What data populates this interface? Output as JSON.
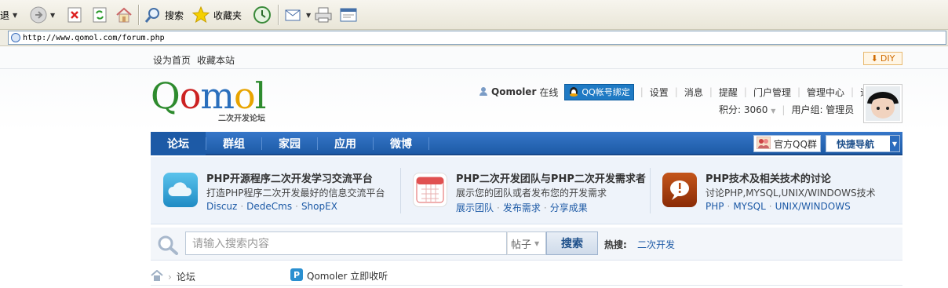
{
  "browser": {
    "toolbar": {
      "back_label": "退",
      "search_label": "搜索",
      "favorites_label": "收藏夹"
    },
    "address": "http://www.qomol.com/forum.php"
  },
  "topbar": {
    "set_home": "设为首页",
    "bookmark": "收藏本站",
    "diy": "DIY"
  },
  "logo": {
    "text": "Qomol",
    "subtitle": "二次开发论坛",
    "letter_colors": [
      "#2e8b2e",
      "#cc2222",
      "#2a6fbd",
      "#e8a400",
      "#2e8b2e"
    ]
  },
  "user": {
    "name": "Qomoler",
    "status": "在线",
    "qq_bind": "QQ帐号绑定",
    "links": [
      "设置",
      "消息",
      "提醒",
      "门户管理",
      "管理中心",
      "退出"
    ],
    "points_label": "积分: 3060",
    "group_label": "用户组: 管理员"
  },
  "nav": {
    "items": [
      "论坛",
      "群组",
      "家园",
      "应用",
      "微博"
    ],
    "active_index": 0,
    "qq_group": "官方QQ群",
    "quick_nav": "快捷导航"
  },
  "intro": [
    {
      "title": "PHP开源程序二次开发学习交流平台",
      "desc": "打造PHP程序二次开发最好的信息交流平台",
      "links": [
        "Discuz",
        "DedeCms",
        "ShopEX"
      ],
      "icon": "cloud-icon",
      "color": "#2a9bd0"
    },
    {
      "title": "PHP二次开发团队与PHP二次开发需求者",
      "desc": "展示您的团队或者发布您的开发需求",
      "links": [
        "展示团队",
        "发布需求",
        "分享成果"
      ],
      "icon": "calendar-icon",
      "color": "#d84a4a"
    },
    {
      "title": "PHP技术及相关技术的讨论",
      "desc": "讨论PHP,MYSQL,UNIX/WINDOWS技术",
      "links": [
        "PHP",
        "MYSQL",
        "UNIX/WINDOWS"
      ],
      "icon": "speech-bubble-icon",
      "color": "#b84a10"
    }
  ],
  "search": {
    "placeholder": "请输入搜索内容",
    "type": "帖子",
    "button": "搜索",
    "hot_label": "热搜:",
    "hot_link": "二次开发"
  },
  "breadcrumb": {
    "current": "论坛",
    "follow": "Qomoler 立即收听"
  }
}
